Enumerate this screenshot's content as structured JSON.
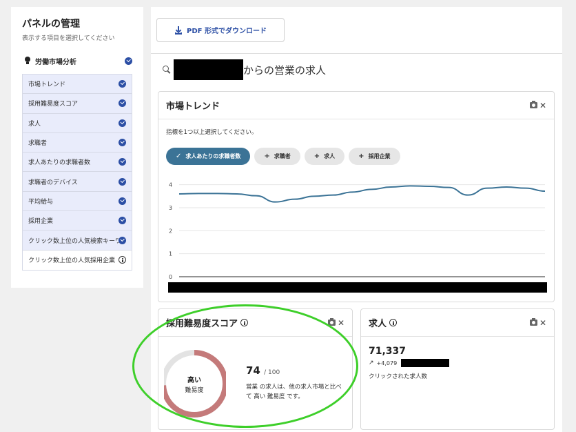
{
  "sidebar": {
    "title": "パネルの管理",
    "subtitle": "表示する項目を選択してください",
    "group_label": "労働市場分析",
    "items": [
      {
        "label": "市場トレンド",
        "state": "checked"
      },
      {
        "label": "採用難易度スコア",
        "state": "checked"
      },
      {
        "label": "求人",
        "state": "checked"
      },
      {
        "label": "求職者",
        "state": "checked"
      },
      {
        "label": "求人あたりの求職者数",
        "state": "checked"
      },
      {
        "label": "求職者のデバイス",
        "state": "checked"
      },
      {
        "label": "平均給与",
        "state": "checked"
      },
      {
        "label": "採用企業",
        "state": "checked"
      },
      {
        "label": "クリック数上位の人気検索キーワード",
        "state": "checked"
      },
      {
        "label": "クリック数上位の人気採用企業",
        "state": "info"
      }
    ]
  },
  "toolbar": {
    "pdf_button_label": "PDF 形式でダウンロード"
  },
  "search": {
    "suffix_text": "からの営業の求人"
  },
  "market_trend": {
    "title": "市場トレンド",
    "hint": "指標を1つ以上選択してください。",
    "chips": [
      {
        "label": "求人あたりの求職者数",
        "active": true
      },
      {
        "label": "求職者",
        "active": false
      },
      {
        "label": "求人",
        "active": false
      },
      {
        "label": "採用企業",
        "active": false
      }
    ]
  },
  "chart_data": {
    "type": "line",
    "x": [
      1,
      2,
      3,
      4,
      5,
      6,
      7,
      8,
      9,
      10,
      11,
      12,
      13,
      14,
      15,
      16,
      17,
      18,
      19,
      20
    ],
    "series": [
      {
        "values": [
          3.6,
          3.62,
          3.62,
          3.6,
          3.52,
          3.25,
          3.37,
          3.5,
          3.55,
          3.68,
          3.8,
          3.9,
          3.95,
          3.93,
          3.88,
          3.55,
          3.85,
          3.9,
          3.85,
          3.72
        ]
      }
    ],
    "yticks": [
      0,
      1,
      2,
      3,
      4
    ],
    "ylim": [
      0,
      4.2
    ],
    "line_color": "#3b7396",
    "grid": true
  },
  "difficulty": {
    "title": "採用難易度スコア",
    "ring_line1": "高い",
    "ring_line2": "難易度",
    "score": "74",
    "score_max": "/ 100",
    "score_fraction": 0.74,
    "description": "営業 の求人は、他の求人市場と比べて 高い 難易度 です。",
    "ring_color": "#c47a7a"
  },
  "jobs": {
    "title": "求人",
    "value": "71,337",
    "delta": "+4,079",
    "description": "クリックされた求人数"
  }
}
